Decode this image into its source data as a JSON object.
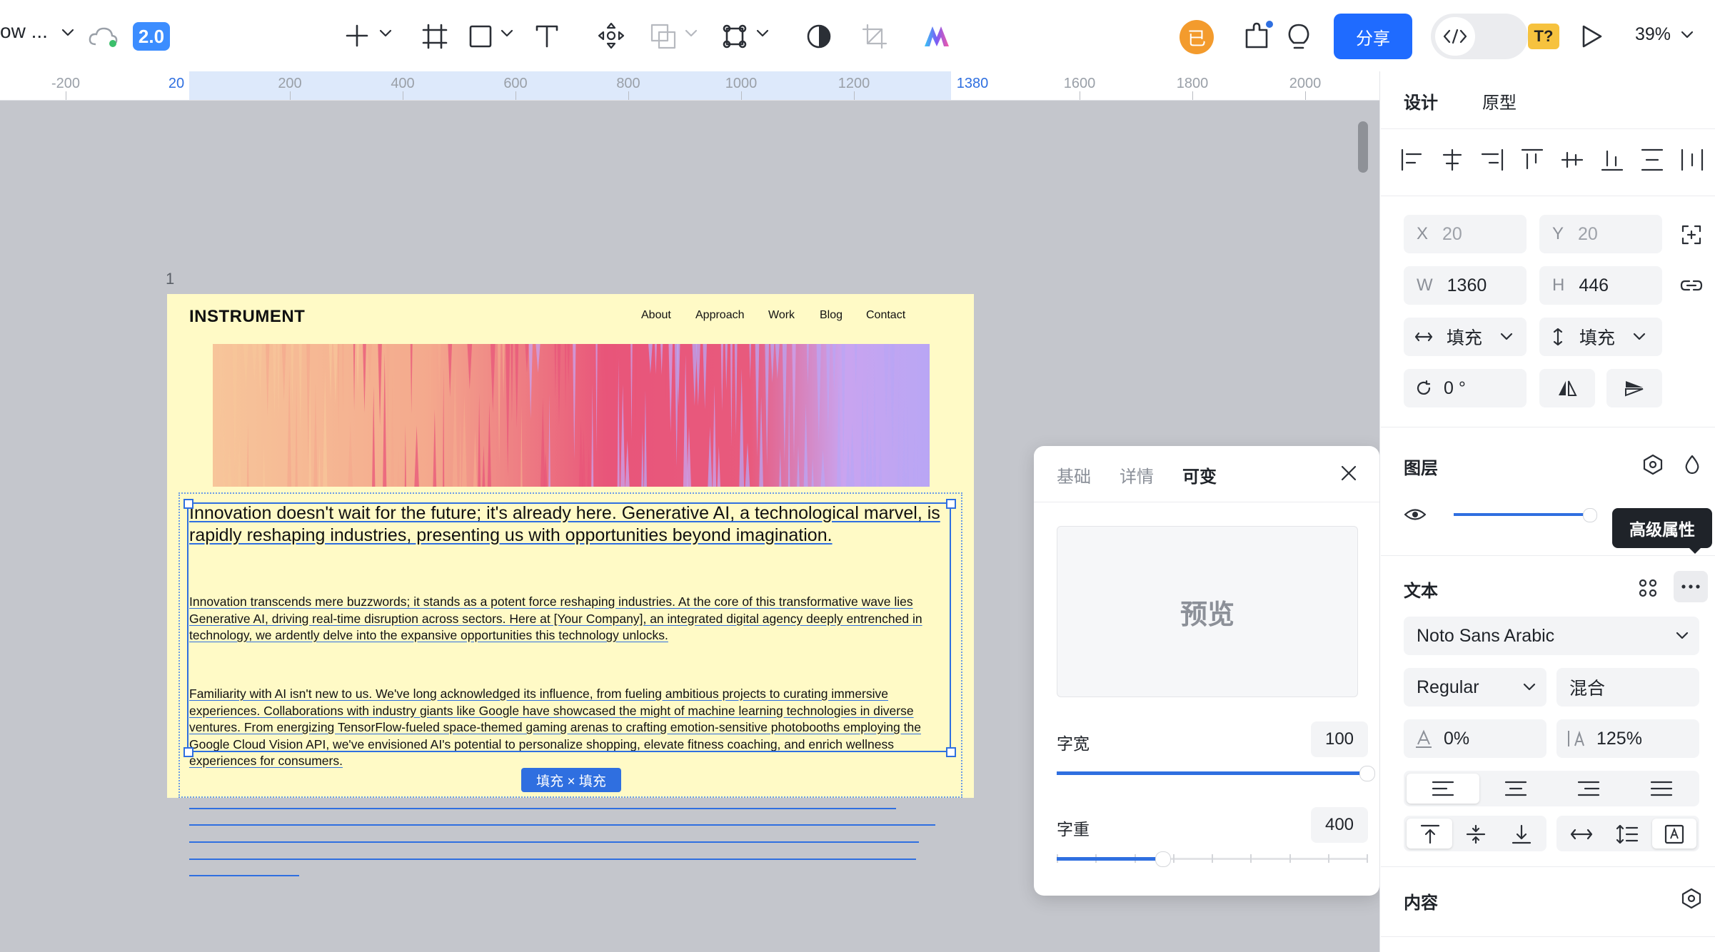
{
  "toolbar": {
    "doc_name": "ow ...",
    "version": "2.0",
    "share": "分享",
    "avatar": "已",
    "missing_font": "T?",
    "zoom": "39%"
  },
  "ruler": {
    "ticks": [
      "-200",
      "20",
      "200",
      "400",
      "600",
      "800",
      "1000",
      "1200",
      "1380",
      "1600",
      "1800",
      "2000"
    ]
  },
  "canvas": {
    "frame_label": "1",
    "brand": "INSTRUMENT",
    "nav": [
      "About",
      "Approach",
      "Work",
      "Blog",
      "Contact"
    ],
    "p1": "Innovation doesn't wait for the future; it's already here. Generative AI, a technological marvel, is rapidly reshaping industries, presenting us with opportunities beyond imagination.",
    "p2": "Innovation transcends mere buzzwords; it stands as a potent force reshaping industries. At the core of this transformative wave lies Generative AI, driving real-time disruption across sectors. Here at [Your Company], an integrated digital agency deeply entrenched in technology, we ardently delve into the expansive opportunities this technology unlocks.",
    "p3": "Familiarity with AI isn't new to us. We've long acknowledged its influence, from fueling ambitious projects to curating immersive experiences. Collaborations with industry giants like Google have showcased the might of machine learning technologies in diverse ventures. From energizing TensorFlow-fueled space-themed gaming arenas to crafting emotion-sensitive photobooths employing the Google Cloud Vision API, we've envisioned AI's potential to personalize shopping, elevate fitness coaching, and enrich wellness experiences for consumers.",
    "sizing_tag": "填充 × 填充",
    "hero_colors": [
      "#f7c59a",
      "#f4a98d",
      "#e8557a",
      "#c9a4f0",
      "#b9a6f4"
    ]
  },
  "popup": {
    "tabs": [
      "基础",
      "详情",
      "可变"
    ],
    "active_tab": "可变",
    "preview": "预览",
    "width_label": "字宽",
    "width_value": "100",
    "weight_label": "字重",
    "weight_value": "400",
    "width_level": 1.0,
    "weight_level": 0.34
  },
  "panel": {
    "tabs": [
      "设计",
      "原型"
    ],
    "x_label": "X",
    "x_value": "20",
    "y_label": "Y",
    "y_value": "20",
    "w_label": "W",
    "w_value": "1360",
    "h_label": "H",
    "h_value": "446",
    "h_sizing": "填充",
    "v_sizing": "填充",
    "rotation": "0 °",
    "layer_title": "图层",
    "opacity_level": 1.0,
    "text_title": "文本",
    "tooltip": "高级属性",
    "font_family": "Noto Sans Arabic",
    "font_style": "Regular",
    "blend": "混合",
    "letter_spacing": "0%",
    "line_height": "125%",
    "content_title": "内容"
  },
  "colors": {
    "accent": "#2f6fe0",
    "share": "#1f6bff",
    "frame_bg": "#fffac6",
    "canvas_bg": "#c4c6cc"
  }
}
